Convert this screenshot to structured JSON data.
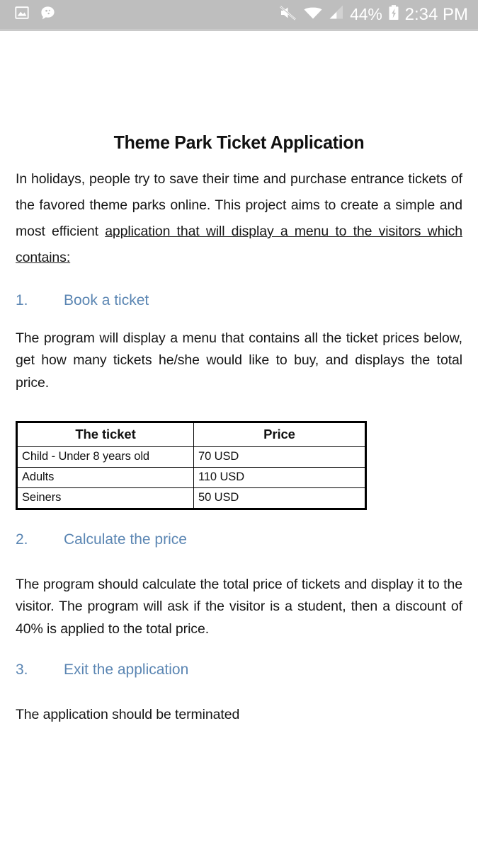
{
  "statusbar": {
    "left_icons": [
      {
        "name": "image-icon",
        "glyph": "image"
      },
      {
        "name": "chat-bubble-icon",
        "glyph": "chat"
      }
    ],
    "right_icons": [
      {
        "name": "volume-mute-icon",
        "glyph": "mute"
      },
      {
        "name": "wifi-icon",
        "glyph": "wifi"
      },
      {
        "name": "cellular-signal-icon",
        "glyph": "signal"
      }
    ],
    "battery_percent": "44%",
    "battery_state": "charging",
    "clock": "2:34 PM",
    "background_color": "#bebebe",
    "foreground_color": "#ffffff"
  },
  "document": {
    "title": "Theme Park Ticket Application",
    "intro": {
      "plain_before": "In holidays, people try to save their time and purchase entrance tickets of the favored theme parks online. This project aims to create a simple and most efficient ",
      "underlined": "application that will display a menu to the visitors which contains:"
    },
    "sections": [
      {
        "number": "1.",
        "heading": "Book a ticket",
        "body": "The program will display a menu that contains all the ticket prices below, get how many tickets he/she would like to buy, and displays the total price.",
        "heading_color": "#5b86b3"
      },
      {
        "number": "2.",
        "heading": "Calculate the price",
        "body": "The program should calculate the total price of tickets and display it to the visitor. The program will ask if the visitor is a student, then a discount of 40% is applied to the total price.",
        "heading_color": "#5b86b3"
      },
      {
        "number": "3.",
        "heading": "Exit the application",
        "body": "The application should be terminated",
        "heading_color": "#5b86b3"
      }
    ],
    "price_table": {
      "headers": [
        "The ticket",
        "Price"
      ],
      "rows": [
        [
          "Child - Under 8 years old",
          "70 USD"
        ],
        [
          "Adults",
          "110 USD"
        ],
        [
          "Seiners",
          "50 USD"
        ]
      ]
    }
  }
}
